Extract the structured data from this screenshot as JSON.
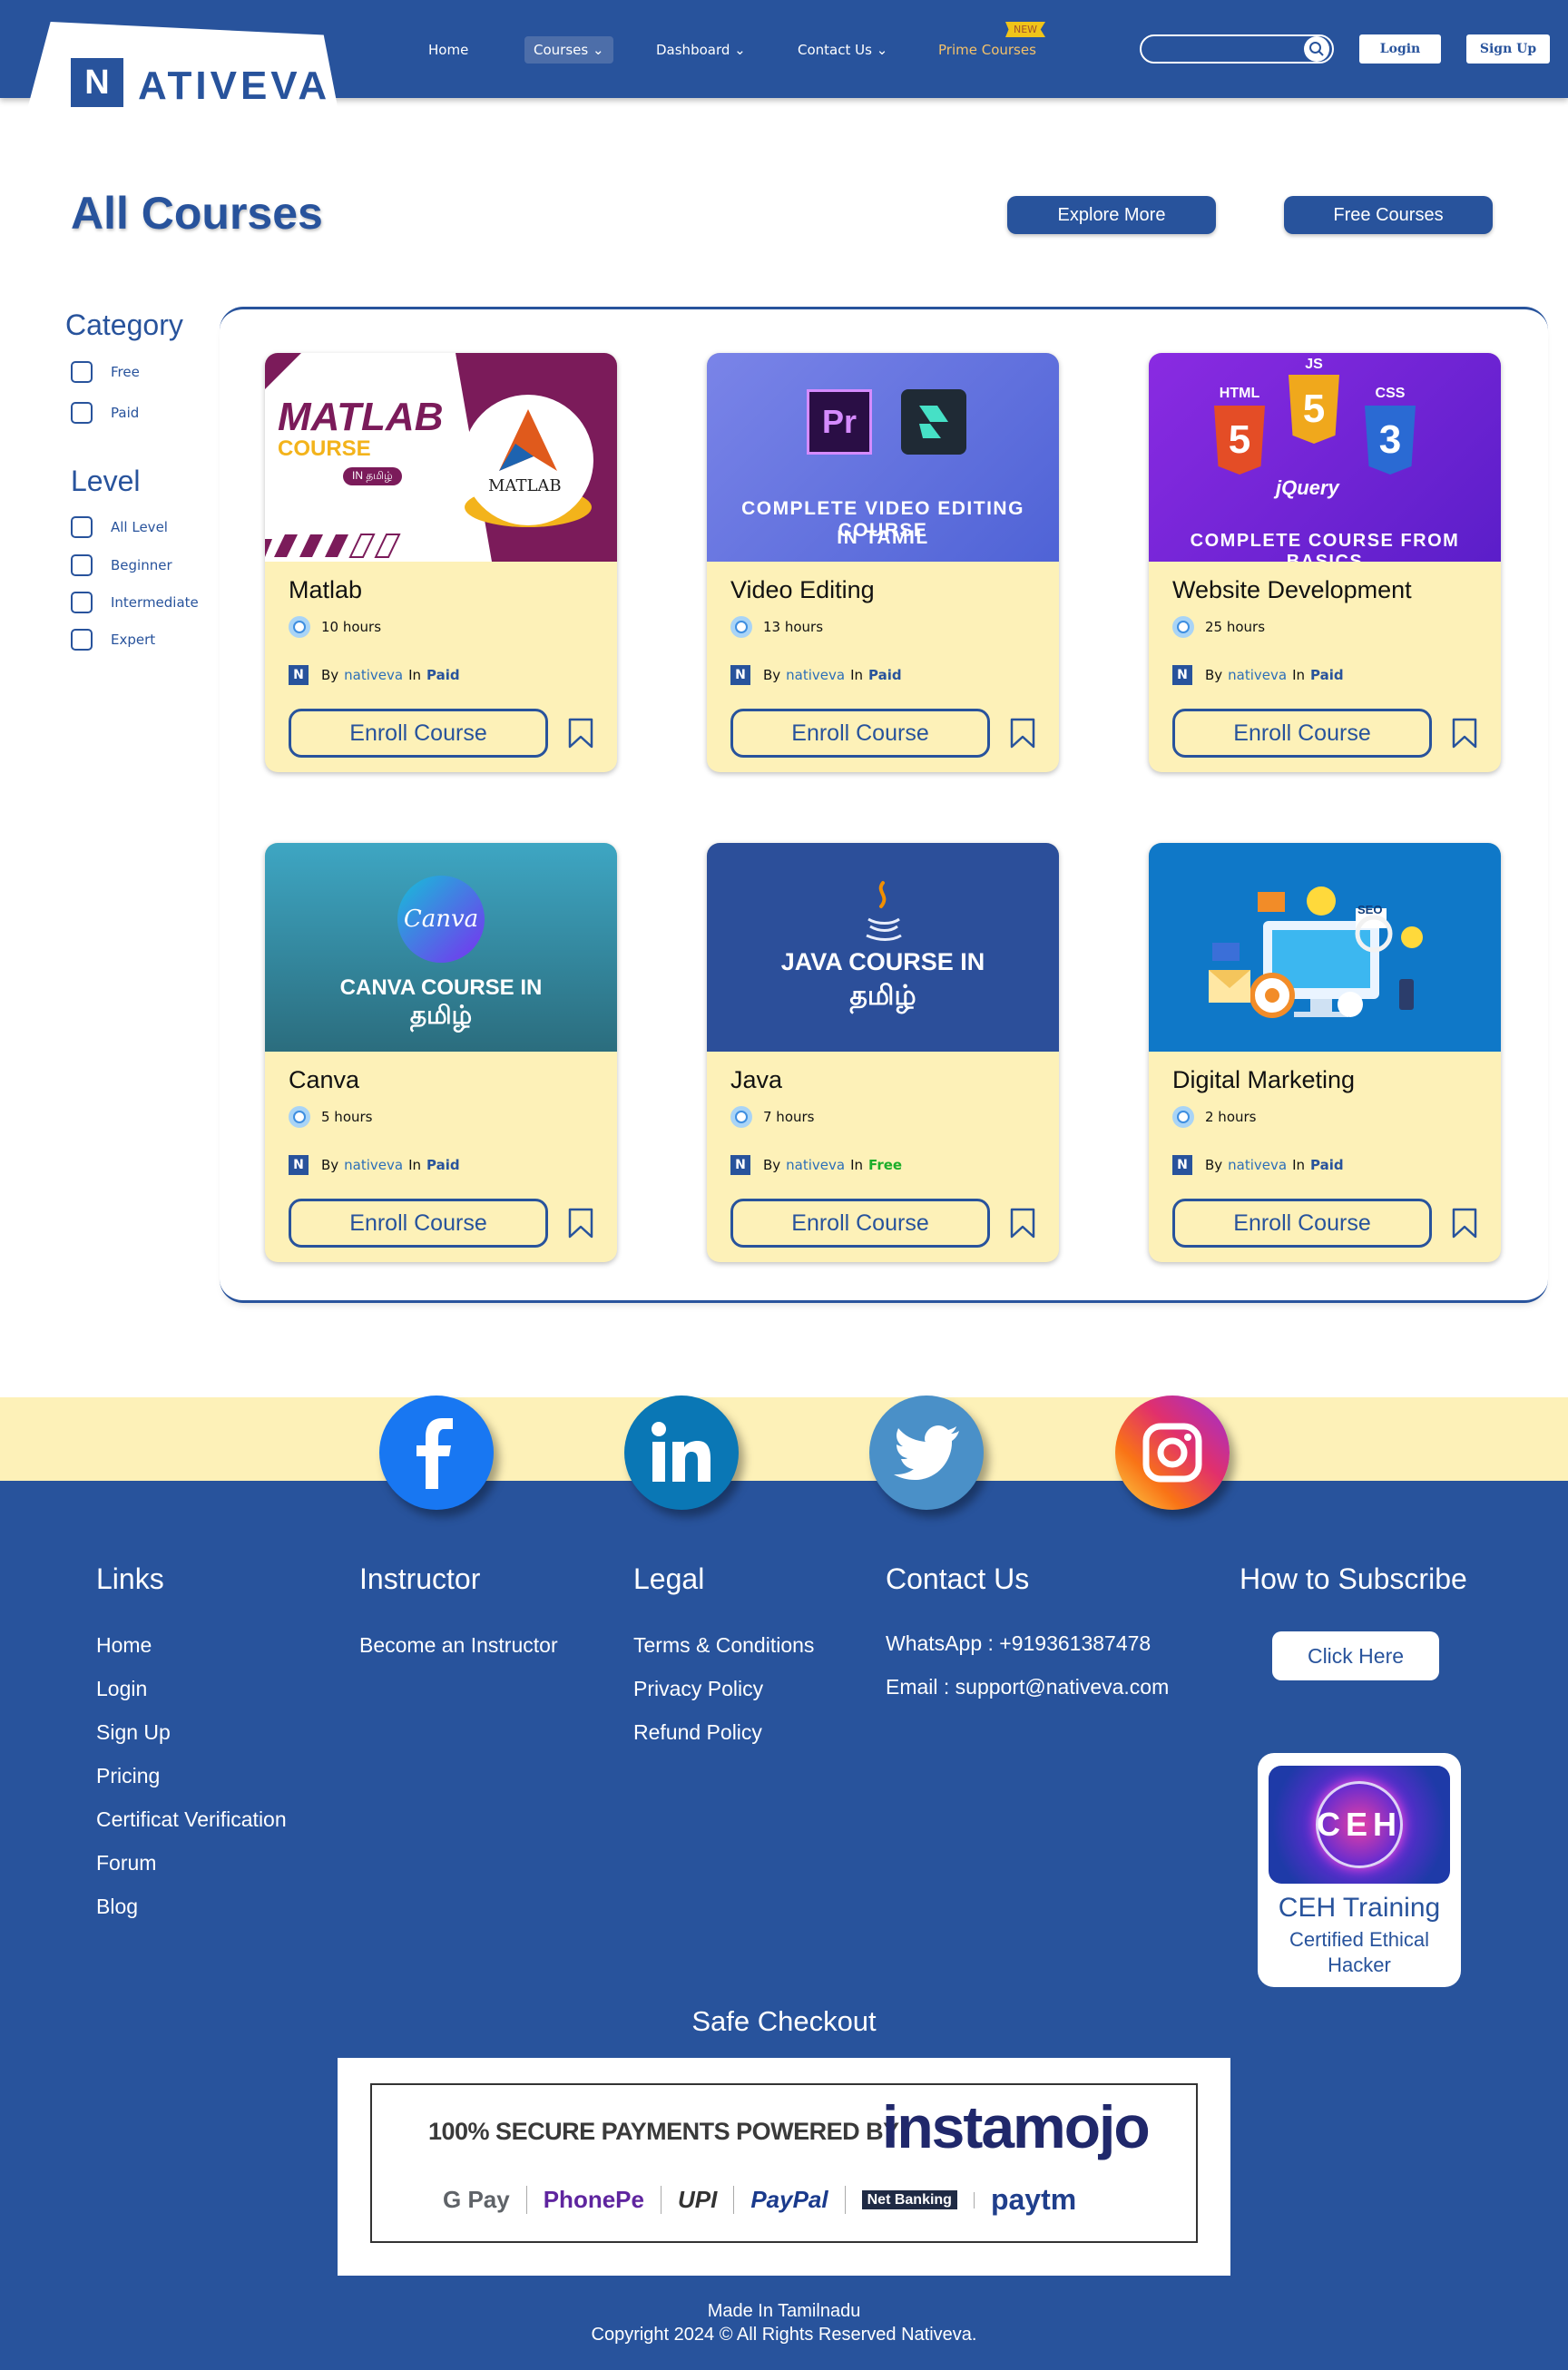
{
  "header": {
    "logo_letter": "N",
    "logo_text": "ATIVEVA",
    "nav": [
      {
        "label": "Home"
      },
      {
        "label": "Courses ⌄"
      },
      {
        "label": "Dashboard ⌄"
      },
      {
        "label": "Contact Us ⌄"
      },
      {
        "label": "Prime Courses"
      }
    ],
    "new_badge": "NEW",
    "search_placeholder": "",
    "login_label": "Login",
    "signup_label": "Sign Up"
  },
  "page": {
    "title": "All Courses",
    "explore_label": "Explore More",
    "free_courses_label": "Free Courses"
  },
  "filters": {
    "category_title": "Category",
    "category_options": [
      "Free",
      "Paid"
    ],
    "level_title": "Level",
    "level_options": [
      "All Level",
      "Beginner",
      "Intermediate",
      "Expert"
    ]
  },
  "courses": [
    {
      "title": "Matlab",
      "hours": "10  hours",
      "by": "By",
      "author": "nativeva",
      "in": "In",
      "type": "Paid",
      "enroll": "Enroll Course",
      "img": {
        "line1": "MATLAB",
        "line2": "COURSE",
        "line3": "IN தமிழ்",
        "logo": "MATLAB"
      }
    },
    {
      "title": "Video Editing",
      "hours": "13  hours",
      "by": "By",
      "author": "nativeva",
      "in": "In",
      "type": "Paid",
      "enroll": "Enroll Course",
      "img": {
        "icon1": "Pr",
        "line1": "COMPLETE VIDEO EDITING COURSE",
        "line2": "IN TAMIL"
      }
    },
    {
      "title": "Website Development",
      "hours": "25  hours",
      "by": "By",
      "author": "nativeva",
      "in": "In",
      "type": "Paid",
      "enroll": "Enroll Course",
      "img": {
        "html": "HTML",
        "js": "JS",
        "css": "CSS",
        "jquery": "jQuery",
        "line1": "COMPLETE COURSE FROM BASICS"
      }
    },
    {
      "title": "Canva",
      "hours": "5  hours",
      "by": "By",
      "author": "nativeva",
      "in": "In",
      "type": "Paid",
      "enroll": "Enroll Course",
      "img": {
        "logo": "Canva",
        "line1": "CANVA COURSE IN",
        "line2": "தமிழ்"
      }
    },
    {
      "title": "Java",
      "hours": "7  hours",
      "by": "By",
      "author": "nativeva",
      "in": "In",
      "type": "Free",
      "enroll": "Enroll Course",
      "img": {
        "line1": "JAVA COURSE IN",
        "line2": "தமிழ்"
      }
    },
    {
      "title": "Digital Marketing",
      "hours": "2  hours",
      "by": "By",
      "author": "nativeva",
      "in": "In",
      "type": "Paid",
      "enroll": "Enroll Course",
      "img": {
        "seo": "SEO"
      }
    }
  ],
  "social": [
    "facebook-icon",
    "linkedin-icon",
    "twitter-icon",
    "instagram-icon"
  ],
  "footer": {
    "links_title": "Links",
    "links": [
      "Home",
      "Login",
      "Sign Up",
      "Pricing",
      "Certificat Verification",
      "Forum",
      "Blog"
    ],
    "instructor_title": "Instructor",
    "instructor_links": [
      "Become an Instructor"
    ],
    "legal_title": "Legal",
    "legal_links": [
      "Terms & Conditions",
      "Privacy Policy",
      "Refund Policy"
    ],
    "contact_title": "Contact Us",
    "whatsapp": "WhatsApp : +919361387478",
    "email": "Email : support@nativeva.com",
    "subscribe_title": "How to Subscribe",
    "subscribe_button": "Click Here",
    "ceh": {
      "badge": "CEH",
      "title": "CEH Training",
      "subtitle": "Certified Ethical Hacker"
    },
    "safe_checkout": "Safe Checkout",
    "payments": {
      "secure_text": "100% SECURE PAYMENTS POWERED BY",
      "brand": "instamojo",
      "methods": [
        "G Pay",
        "PhonePe",
        "UPI",
        "PayPal",
        "Net Banking",
        "paytm"
      ]
    },
    "made_in": "Made In Tamilnadu",
    "copyright": "Copyright 2024 © All Rights Reserved Nativeva."
  },
  "colors": {
    "primary": "#28539c",
    "card_bg": "#fdf1b8",
    "free": "#1cae2a",
    "prime": "#f3c16a"
  }
}
